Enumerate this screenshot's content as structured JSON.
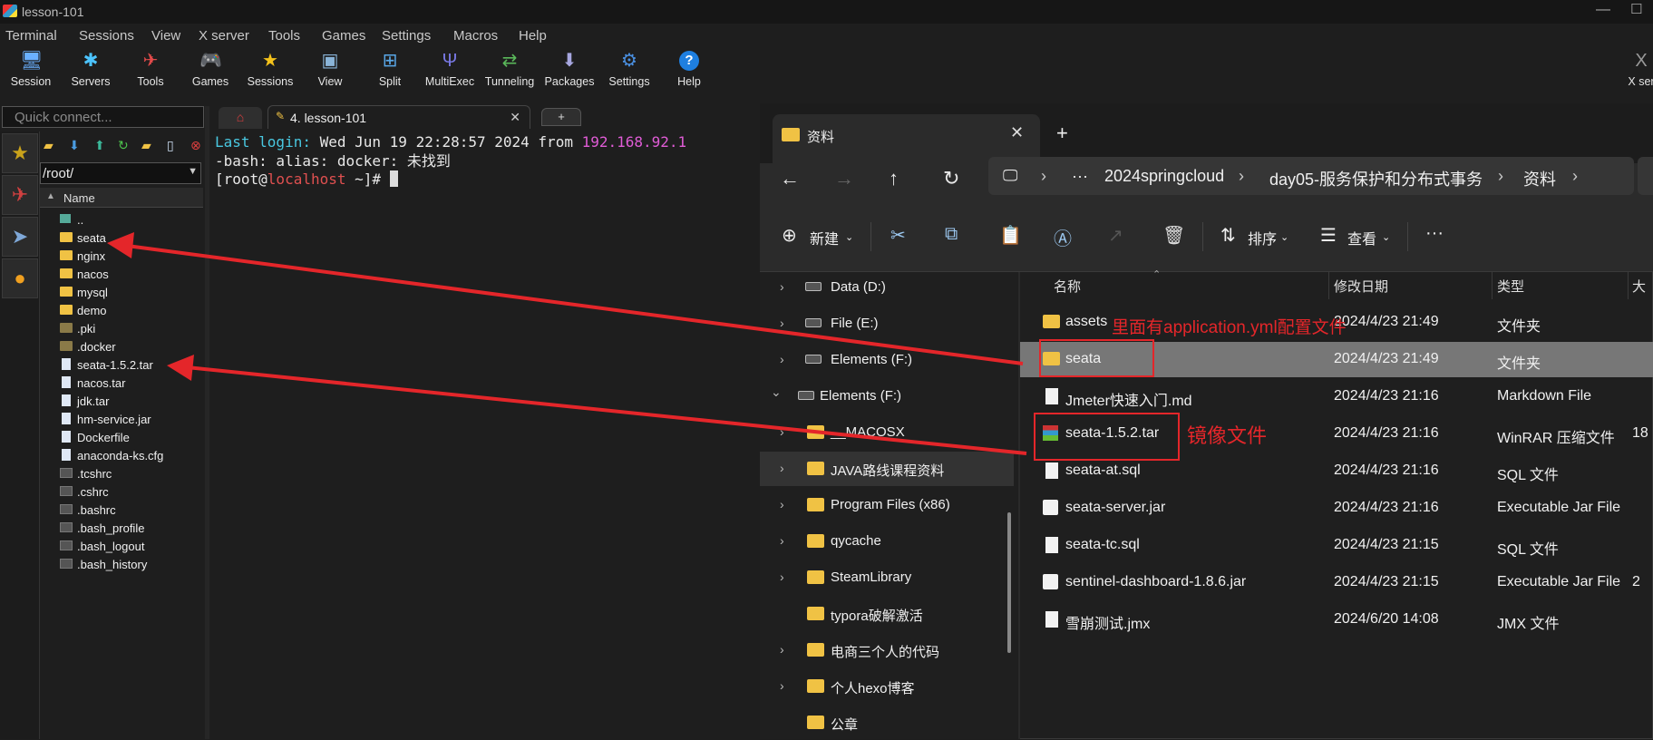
{
  "window_title": "lesson-101",
  "menu": [
    "Terminal",
    "Sessions",
    "View",
    "X server",
    "Tools",
    "Games",
    "Settings",
    "Macros",
    "Help"
  ],
  "toolbar": [
    {
      "label": "Session",
      "icon": "session-icon"
    },
    {
      "label": "Servers",
      "icon": "servers-icon"
    },
    {
      "label": "Tools",
      "icon": "tools-icon"
    },
    {
      "label": "Games",
      "icon": "games-icon"
    },
    {
      "label": "Sessions",
      "icon": "star-icon"
    },
    {
      "label": "View",
      "icon": "view-icon"
    },
    {
      "label": "Split",
      "icon": "split-icon"
    },
    {
      "label": "MultiExec",
      "icon": "multiexec-icon"
    },
    {
      "label": "Tunneling",
      "icon": "tunneling-icon"
    },
    {
      "label": "Packages",
      "icon": "packages-icon"
    },
    {
      "label": "Settings",
      "icon": "gear-icon"
    },
    {
      "label": "Help",
      "icon": "help-icon"
    }
  ],
  "toolbar_right_label": "X ser",
  "quick_connect": {
    "placeholder": "Quick connect..."
  },
  "sftp": {
    "path": "/root/",
    "column_header": "Name",
    "files": [
      {
        "name": "..",
        "kind": "up"
      },
      {
        "name": "seata",
        "kind": "folder"
      },
      {
        "name": "nginx",
        "kind": "folder"
      },
      {
        "name": "nacos",
        "kind": "folder"
      },
      {
        "name": "mysql",
        "kind": "folder"
      },
      {
        "name": "demo",
        "kind": "folder"
      },
      {
        "name": ".pki",
        "kind": "folderdark"
      },
      {
        "name": ".docker",
        "kind": "folderdark"
      },
      {
        "name": "seata-1.5.2.tar",
        "kind": "file"
      },
      {
        "name": "nacos.tar",
        "kind": "file"
      },
      {
        "name": "jdk.tar",
        "kind": "file"
      },
      {
        "name": "hm-service.jar",
        "kind": "file"
      },
      {
        "name": "Dockerfile",
        "kind": "file"
      },
      {
        "name": "anaconda-ks.cfg",
        "kind": "file"
      },
      {
        "name": ".tcshrc",
        "kind": "dot"
      },
      {
        "name": ".cshrc",
        "kind": "dot"
      },
      {
        "name": ".bashrc",
        "kind": "dot"
      },
      {
        "name": ".bash_profile",
        "kind": "dot"
      },
      {
        "name": ".bash_logout",
        "kind": "dot"
      },
      {
        "name": ".bash_history",
        "kind": "dot"
      }
    ]
  },
  "tabs": {
    "active_tab": "4. lesson-101",
    "plus": "+"
  },
  "terminal": {
    "line1_prefix": "Last login:",
    "line1_mid": " Wed Jun 19 22:28:57 2024 ",
    "line1_from": "from",
    "line1_ip": " 192.168.92.1",
    "line2": "-bash: alias: docker: 未找到",
    "prompt_open": "[root@",
    "prompt_host": "localhost",
    "prompt_close": " ~]# "
  },
  "explorer": {
    "tab_title": "资料",
    "new_tab": "+",
    "breadcrumb": [
      "···",
      "2024springcloud",
      "day05-服务保护和分布式事务",
      "资料"
    ],
    "commands": {
      "new": "新建",
      "sort": "排序",
      "view": "查看",
      "more": "···"
    },
    "nav_items": [
      {
        "label": "Data (D:)",
        "icon": "drive",
        "chevron": "›"
      },
      {
        "label": "File (E:)",
        "icon": "drive",
        "chevron": "›"
      },
      {
        "label": "Elements (F:)",
        "icon": "drive",
        "chevron": "›"
      },
      {
        "label": "Elements (F:)",
        "icon": "drive",
        "chevron": "⌄"
      },
      {
        "label": "__MACOSX",
        "icon": "folder",
        "chevron": "›"
      },
      {
        "label": "JAVA路线课程资料",
        "icon": "folder",
        "chevron": "›"
      },
      {
        "label": "Program Files (x86)",
        "icon": "folder",
        "chevron": "›"
      },
      {
        "label": "qycache",
        "icon": "folder",
        "chevron": "›"
      },
      {
        "label": "SteamLibrary",
        "icon": "folder",
        "chevron": "›"
      },
      {
        "label": "typora破解激活",
        "icon": "folder",
        "chevron": ""
      },
      {
        "label": "电商三个人的代码",
        "icon": "folder",
        "chevron": "›"
      },
      {
        "label": "个人hexo博客",
        "icon": "folder",
        "chevron": "›"
      },
      {
        "label": "公章",
        "icon": "folder",
        "chevron": ""
      }
    ],
    "columns": [
      "名称",
      "修改日期",
      "类型",
      "大"
    ],
    "files": [
      {
        "name": "assets",
        "date": "2024/4/23 21:49",
        "type": "文件夹",
        "size": "",
        "icon": "folder"
      },
      {
        "name": "seata",
        "date": "2024/4/23 21:49",
        "type": "文件夹",
        "size": "",
        "icon": "folder"
      },
      {
        "name": "Jmeter快速入门.md",
        "date": "2024/4/23 21:16",
        "type": "Markdown File",
        "size": "",
        "icon": "doc"
      },
      {
        "name": "seata-1.5.2.tar",
        "date": "2024/4/23 21:16",
        "type": "WinRAR 压缩文件",
        "size": "18",
        "icon": "rar"
      },
      {
        "name": "seata-at.sql",
        "date": "2024/4/23 21:16",
        "type": "SQL 文件",
        "size": "",
        "icon": "doc"
      },
      {
        "name": "seata-server.jar",
        "date": "2024/4/23 21:16",
        "type": "Executable Jar File",
        "size": "",
        "icon": "jar"
      },
      {
        "name": "seata-tc.sql",
        "date": "2024/4/23 21:15",
        "type": "SQL 文件",
        "size": "",
        "icon": "doc"
      },
      {
        "name": "sentinel-dashboard-1.8.6.jar",
        "date": "2024/4/23 21:15",
        "type": "Executable Jar File",
        "size": "2",
        "icon": "jar"
      },
      {
        "name": "雪崩测试.jmx",
        "date": "2024/6/20 14:08",
        "type": "JMX 文件",
        "size": "",
        "icon": "doc"
      }
    ]
  },
  "annotations": {
    "assets_note": "里面有application.yml配置文件",
    "image_note": "镜像文件"
  },
  "colors": {
    "annotation_red": "#e4262a",
    "folder_yellow": "#f0c244",
    "term_cyan": "#49c7e0",
    "term_magenta": "#e05cd6"
  }
}
